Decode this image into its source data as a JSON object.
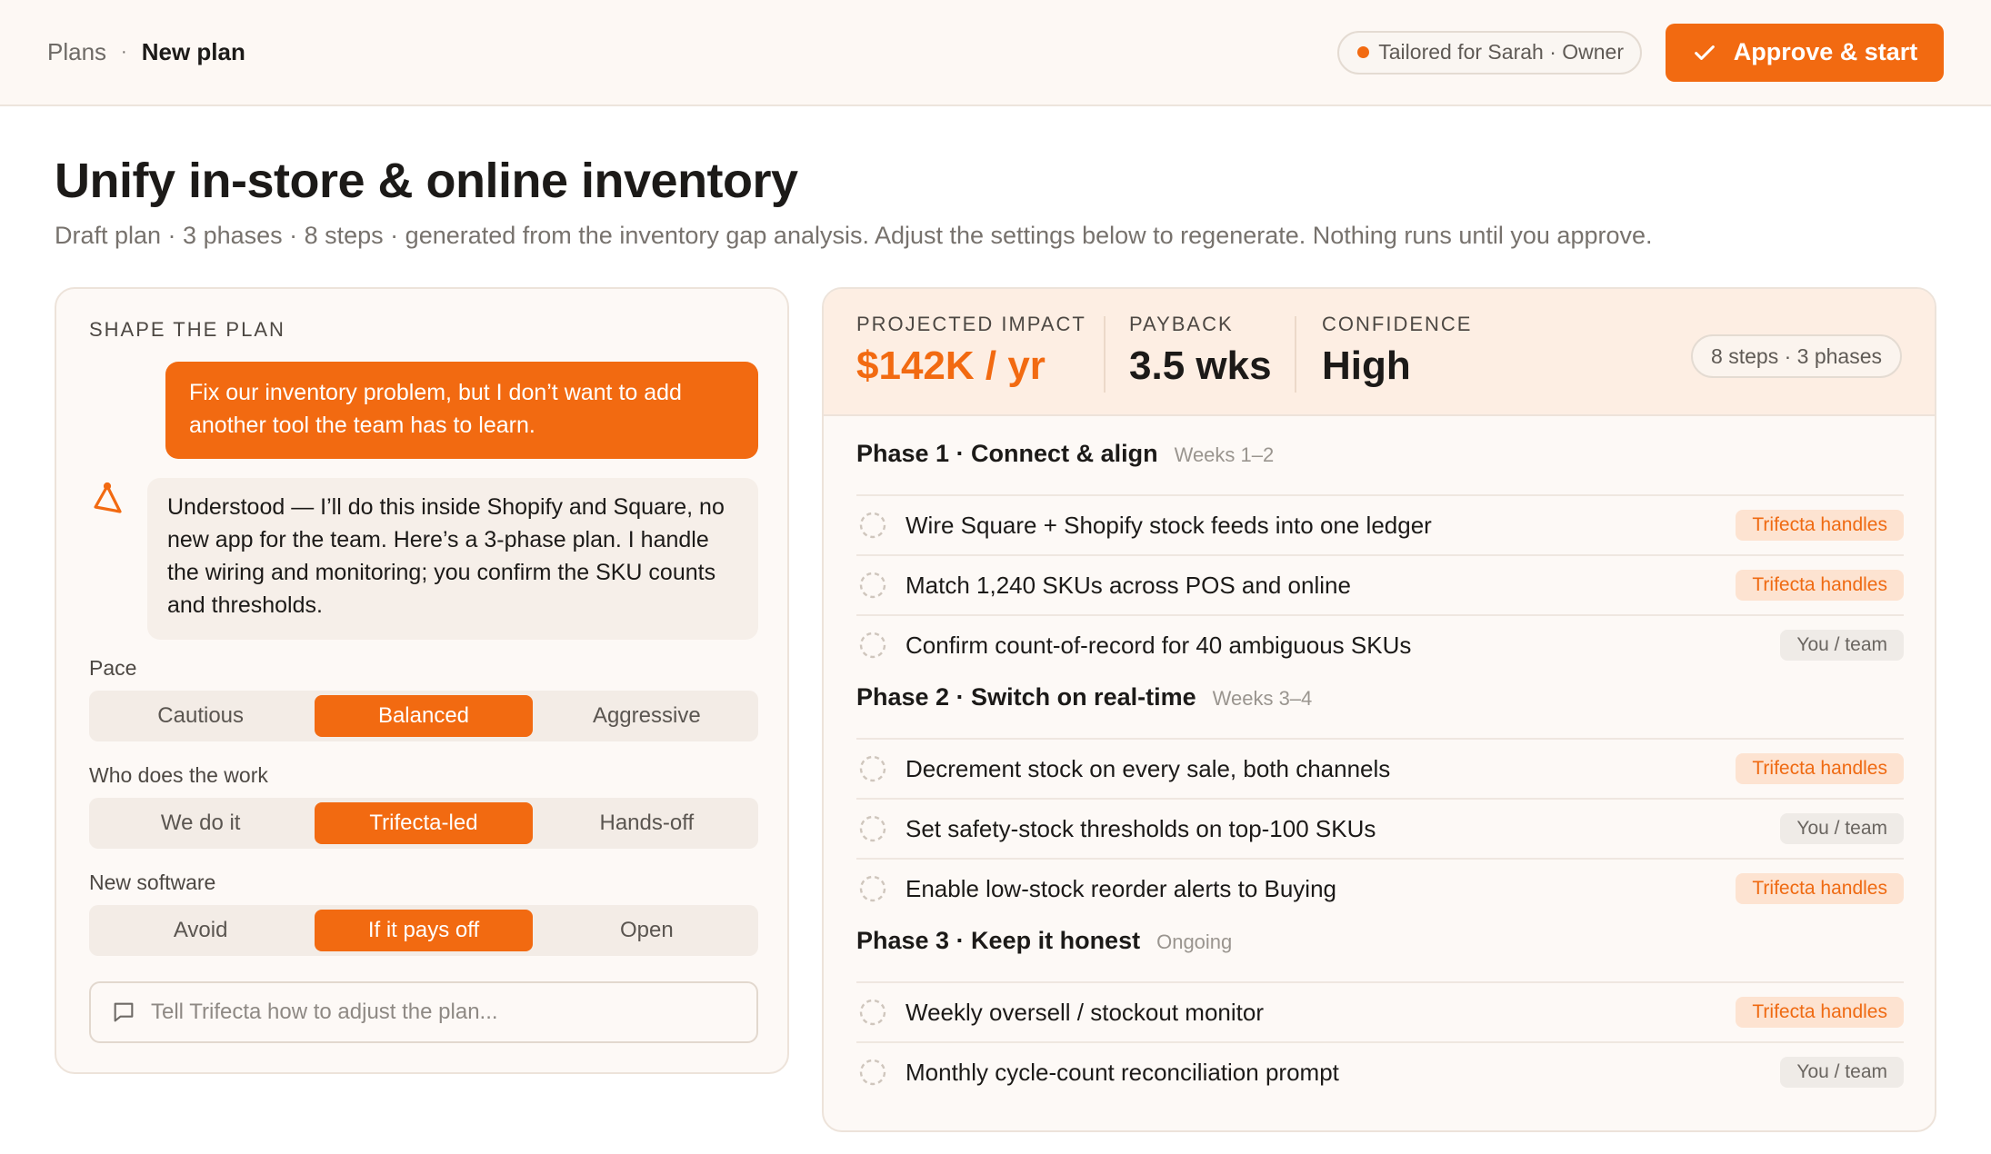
{
  "breadcrumb": {
    "root": "Plans",
    "separator": "·",
    "current": "New plan"
  },
  "header": {
    "tailored": "Tailored for Sarah · Owner",
    "approve_label": "Approve & start"
  },
  "page": {
    "title": "Unify in-store & online inventory",
    "subtitle": "Draft plan · 3 phases · 8 steps · generated from the inventory gap analysis. Adjust the settings below to regenerate. Nothing runs until you approve."
  },
  "shape": {
    "section_label": "SHAPE THE PLAN",
    "user_message": "Fix our inventory problem, but I don’t want to add another tool the team has to learn.",
    "bot_message": "Understood — I’ll do this inside Shopify and Square, no new app for the team. Here’s a 3-phase plan. I handle the wiring and monitoring; you confirm the SKU counts and thresholds.",
    "pace": {
      "label": "Pace",
      "options": [
        "Cautious",
        "Balanced",
        "Aggressive"
      ],
      "selected": "Balanced"
    },
    "who": {
      "label": "Who does the work",
      "options": [
        "We do it",
        "Trifecta-led",
        "Hands-off"
      ],
      "selected": "Trifecta-led"
    },
    "software": {
      "label": "New software",
      "options": [
        "Avoid",
        "If it pays off",
        "Open"
      ],
      "selected": "If it pays off"
    },
    "input_placeholder": "Tell Trifecta how to adjust the plan..."
  },
  "metrics": {
    "impact": {
      "label": "PROJECTED IMPACT",
      "value": "$142K / yr"
    },
    "payback": {
      "label": "PAYBACK",
      "value": "3.5 wks"
    },
    "confidence": {
      "label": "CONFIDENCE",
      "value": "High"
    },
    "summary": "8 steps · 3 phases"
  },
  "phases": [
    {
      "title": "Phase 1 · Connect & align",
      "when": "Weeks 1–2",
      "steps": [
        {
          "text": "Wire Square + Shopify stock feeds into one ledger",
          "owner": "Trifecta handles"
        },
        {
          "text": "Match 1,240 SKUs across POS and online",
          "owner": "Trifecta handles"
        },
        {
          "text": "Confirm count-of-record for 40 ambiguous SKUs",
          "owner": "You / team"
        }
      ]
    },
    {
      "title": "Phase 2 · Switch on real-time",
      "when": "Weeks 3–4",
      "steps": [
        {
          "text": "Decrement stock on every sale, both channels",
          "owner": "Trifecta handles"
        },
        {
          "text": "Set safety-stock thresholds on top-100 SKUs",
          "owner": "You / team"
        },
        {
          "text": "Enable low-stock reorder alerts to Buying",
          "owner": "Trifecta handles"
        }
      ]
    },
    {
      "title": "Phase 3 · Keep it honest",
      "when": "Ongoing",
      "steps": [
        {
          "text": "Weekly oversell / stockout monitor",
          "owner": "Trifecta handles"
        },
        {
          "text": "Monthly cycle-count reconciliation prompt",
          "owner": "You / team"
        }
      ]
    }
  ],
  "colors": {
    "accent": "#f26a11",
    "accent_soft": "#fde3d1",
    "page_bg": "#ffffff",
    "card_bg": "#fdf9f6"
  },
  "icons": {
    "approve": "check-icon",
    "bot": "trifecta-logo-icon",
    "input": "chat-bubble-icon",
    "step": "dashed-circle-icon"
  }
}
